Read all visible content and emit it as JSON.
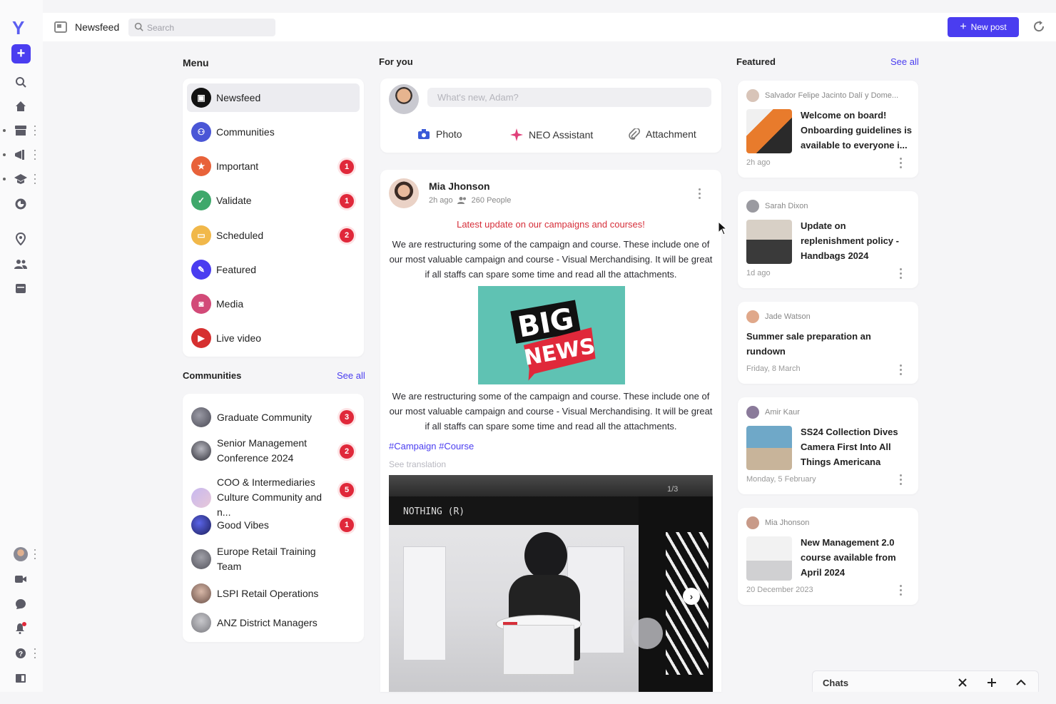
{
  "topbar": {
    "title": "Newsfeed",
    "search_placeholder": "Search",
    "new_post_label": "New post"
  },
  "menu": {
    "title": "Menu",
    "items": [
      {
        "label": "Newsfeed",
        "color": "#111111",
        "badge": ""
      },
      {
        "label": "Communities",
        "color": "#4a56d6",
        "badge": ""
      },
      {
        "label": "Important",
        "color": "#e8623a",
        "badge": "1"
      },
      {
        "label": "Validate",
        "color": "#3fa86b",
        "badge": "1"
      },
      {
        "label": "Scheduled",
        "color": "#f1b84a",
        "badge": "2"
      },
      {
        "label": "Featured",
        "color": "#4a3df0",
        "badge": ""
      },
      {
        "label": "Media",
        "color": "#d24a78",
        "badge": ""
      },
      {
        "label": "Live video",
        "color": "#d63030",
        "badge": ""
      }
    ]
  },
  "communities": {
    "title": "Communities",
    "see_all": "See all",
    "items": [
      {
        "label": "Graduate Community",
        "badge": "3"
      },
      {
        "label": "Senior Management Conference 2024",
        "badge": "2"
      },
      {
        "label": "COO & Intermediaries Culture Community and n...",
        "badge": "5"
      },
      {
        "label": "Good Vibes",
        "badge": "1"
      },
      {
        "label": "Europe Retail Training Team",
        "badge": ""
      },
      {
        "label": "LSPI Retail Operations",
        "badge": ""
      },
      {
        "label": "ANZ District Managers",
        "badge": ""
      }
    ]
  },
  "feed": {
    "title": "For you",
    "composer_placeholder": "What's new, Adam?",
    "actions": {
      "photo": "Photo",
      "assistant": "NEO Assistant",
      "attachment": "Attachment"
    },
    "post": {
      "author": "Mia Jhonson",
      "time": "2h ago",
      "audience": "260 People",
      "headline": "Latest update on our campaigns and courses!",
      "body": "We are restructuring some of the campaign and course. These include one of our most valuable campaign and course - Visual Merchandising. It will be great if all staffs can spare some time and read all the attachments.",
      "image_line1": "BIG",
      "image_line2": "NEWS",
      "hashtags": "#Campaign #Course",
      "see_translation": "See translation",
      "photo_counter": "1/3",
      "photo_sign": "NOTHING (R)"
    }
  },
  "featured": {
    "title": "Featured",
    "see_all": "See all",
    "items": [
      {
        "author": "Salvador Felipe Jacinto Dalí y Dome...",
        "title": "Welcome on board! Onboarding guidelines is available to everyone i...",
        "date": "2h ago"
      },
      {
        "author": "Sarah Dixon",
        "title": "Update on replenishment policy - Handbags 2024",
        "date": "1d ago"
      },
      {
        "author": "Jade Watson",
        "title": "Summer sale preparation an rundown",
        "date": "Friday, 8 March"
      },
      {
        "author": "Amir Kaur",
        "title": "SS24 Collection Dives Camera First Into All Things Americana",
        "date": "Monday, 5 February"
      },
      {
        "author": "Mia Jhonson",
        "title": "New Management 2.0 course available from April 2024",
        "date": "20 December 2023"
      }
    ]
  },
  "chats": {
    "label": "Chats"
  }
}
